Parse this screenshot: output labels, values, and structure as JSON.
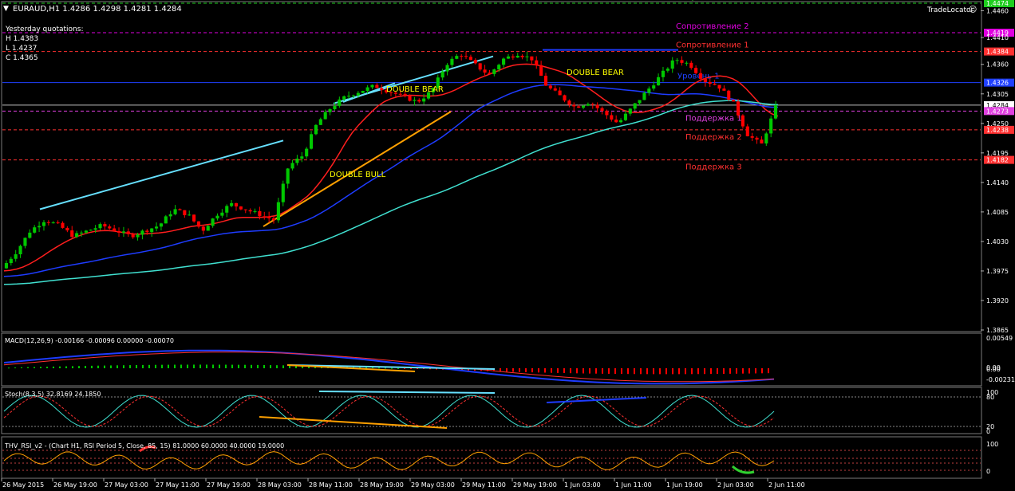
{
  "window": {
    "menu_arrow_icon": "triangle-down-icon",
    "symbol_line": "EURAUD,H1  1.4286 1.4298 1.4281 1.4284",
    "tradelocator": "TradeLocator",
    "tradelocator_icon": "smiley-icon"
  },
  "quotes": {
    "title": "Yesterday quotations:",
    "high": "H 1.4383",
    "low": "L 1.4237",
    "close": "C 1.4365"
  },
  "colors": {
    "background": "#000000",
    "grid": "#1e2a3a",
    "bull": "#00c800",
    "bear": "#ff0000",
    "ma_red": "#ff1e1e",
    "ma_blue": "#1e3cff",
    "ma_cyan": "#40e0d0",
    "trend_cyan": "#66e0ff",
    "trend_orange": "#ffa000",
    "text_yellow": "#ffff00"
  },
  "chart_data": [
    {
      "type": "candlestick",
      "symbol": "EURAUD",
      "timeframe": "H1",
      "ylim": [
        1.3865,
        1.4474
      ],
      "yticks": [
        "1.4460",
        "1.4410",
        "1.4360",
        "1.4305",
        "1.4250",
        "1.4195",
        "1.4140",
        "1.4085",
        "1.4030",
        "1.3975",
        "1.3920",
        "1.3865"
      ],
      "xticks": [
        "26 May 2015",
        "26 May 19:00",
        "27 May 03:00",
        "27 May 11:00",
        "27 May 19:00",
        "28 May 03:00",
        "28 May 11:00",
        "28 May 19:00",
        "29 May 03:00",
        "29 May 11:00",
        "29 May 19:00",
        "1 Jun 03:00",
        "1 Jun 11:00",
        "1 Jun 19:00",
        "2 Jun 03:00",
        "2 Jun 11:00"
      ],
      "close_path": [
        1.398,
        1.401,
        1.405,
        1.407,
        1.406,
        1.404,
        1.405,
        1.406,
        1.405,
        1.404,
        1.405,
        1.406,
        1.409,
        1.408,
        1.405,
        1.408,
        1.41,
        1.409,
        1.408,
        1.407,
        1.417,
        1.419,
        1.425,
        1.428,
        1.43,
        1.431,
        1.432,
        1.431,
        1.43,
        1.429,
        1.431,
        1.436,
        1.438,
        1.436,
        1.434,
        1.437,
        1.438,
        1.437,
        1.432,
        1.43,
        1.428,
        1.429,
        1.427,
        1.425,
        1.428,
        1.431,
        1.434,
        1.437,
        1.436,
        1.433,
        1.432,
        1.429,
        1.423,
        1.421,
        1.428
      ],
      "horizontal_levels": [
        {
          "label": "Сопротивление 3",
          "price": 1.4474,
          "price_tag": "1.4474",
          "color": "#1ecd1e"
        },
        {
          "label": "Сопротивление 2",
          "price": 1.4419,
          "price_tag": "1.4419",
          "color": "#e000e0"
        },
        {
          "label": "Сопротивление 1",
          "price": 1.4384,
          "price_tag": "1.4384",
          "color": "#ff3030"
        },
        {
          "label": "Уровень",
          "price": 1.4326,
          "price_tag": "1.4326",
          "color": "#2040ff"
        },
        {
          "label": "",
          "price": 1.4284,
          "price_tag": "1.4284",
          "color": "#c0c0c0"
        },
        {
          "label": "Поддержка 1",
          "price": 1.4273,
          "price_tag": "1.4273",
          "color": "#e040e0"
        },
        {
          "label": "Поддержка 2",
          "price": 1.4238,
          "price_tag": "1.4238",
          "color": "#ff3030"
        },
        {
          "label": "Поддержка 3",
          "price": 1.4182,
          "price_tag": "1.4182",
          "color": "#ff3030"
        }
      ],
      "annotations": [
        "DOUBLE BEAR",
        "DOUBLE BEAR",
        "DOUBLE BULL"
      ]
    },
    {
      "type": "line",
      "name": "MACD",
      "header": "MACD(12,26,9) -0.00166 -0.00096 0.00000 -0.00070",
      "yticks": [
        "0.00549",
        "0.00",
        "0.00",
        "-0.00231"
      ],
      "ylim": [
        -0.00231,
        0.00549
      ]
    },
    {
      "type": "line",
      "name": "Stoch",
      "header": "Stoch(8,3,5) 32.8169 24.1850",
      "yticks": [
        "100",
        "80",
        "20",
        "0"
      ],
      "ylim": [
        0,
        100
      ]
    },
    {
      "type": "line",
      "name": "THV RSI",
      "header": "THV_RSI_v2 - (Chart H1,  RSI Period 5,  Close,  85,  15)  81.0000 60.0000 40.0000 19.0000",
      "yticks": [
        "100",
        "0"
      ],
      "ylim": [
        0,
        100
      ]
    }
  ]
}
